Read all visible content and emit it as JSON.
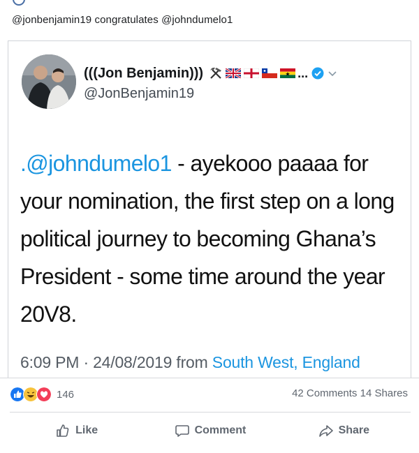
{
  "post": {
    "caption": "@jonbenjamin19 congratulates @johndumelo1"
  },
  "tweet": {
    "display_name": "(((Jon Benjamin)))",
    "handle": "@JonBenjamin19",
    "ellipsis": "...",
    "mention": ".@johndumelo1",
    "text_rest": " - ayekooo paaaa for\nyour nomination, the first step on a long\npolitical journey to becoming Ghana’s\nPresident - some time around the year\n20V8.",
    "time_date": "6:09 PM · 24/08/2019 from ",
    "location": "South West, England",
    "colors": {
      "link": "#1b95e0",
      "verified": "#1da1f2"
    },
    "icons": [
      "hammer-pick-icon",
      "uk-flag-icon",
      "england-flag-icon",
      "chile-flag-icon",
      "ghana-flag-icon",
      "verified-icon",
      "chevron-down-icon"
    ]
  },
  "stats": {
    "reaction_count": "146",
    "comments": "42 Comments",
    "shares": "14 Shares"
  },
  "actions": {
    "like": "Like",
    "comment": "Comment",
    "share": "Share"
  }
}
